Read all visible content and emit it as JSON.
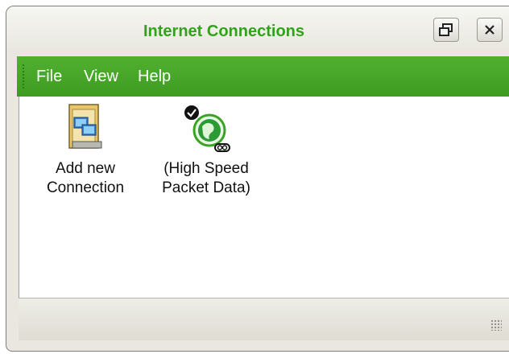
{
  "window": {
    "title": "Internet Connections",
    "accent_color": "#3fa224",
    "title_color": "#31a31a"
  },
  "titlebar_buttons": [
    {
      "name": "restore",
      "icon": "restore-icon"
    },
    {
      "name": "close",
      "icon": "close-icon"
    }
  ],
  "menu": {
    "items": [
      "File",
      "View",
      "Help"
    ]
  },
  "content": {
    "items": [
      {
        "label": "Add new\nConnection",
        "icon": "network-connection-icon"
      },
      {
        "label": "(High Speed\nPacket Data)",
        "icon": "globe-connected-icon"
      }
    ]
  },
  "statusbar": {
    "icon": "resize-grip-icon"
  }
}
